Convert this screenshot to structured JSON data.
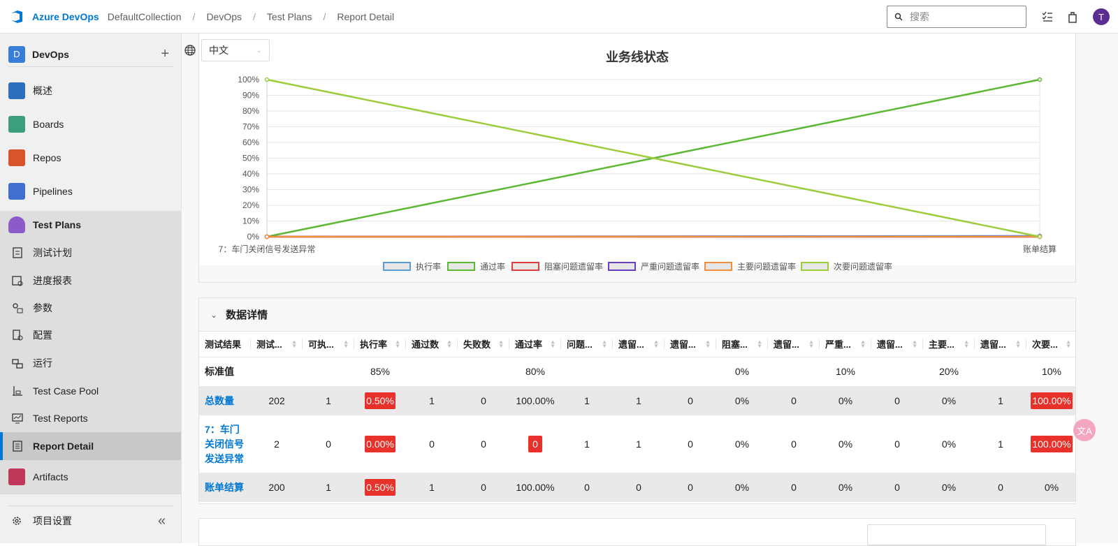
{
  "topbar": {
    "brand": "Azure DevOps",
    "breadcrumbs": [
      "DefaultCollection",
      "DevOps",
      "Test Plans",
      "Report Detail"
    ],
    "search_placeholder": "搜索",
    "avatar_initial": "T"
  },
  "sidebar": {
    "project_initial": "D",
    "project_name": "DevOps",
    "project_add": "+",
    "items": [
      {
        "label": "概述",
        "icon": "overview-icon"
      },
      {
        "label": "Boards",
        "icon": "boards-icon"
      },
      {
        "label": "Repos",
        "icon": "repos-icon"
      },
      {
        "label": "Pipelines",
        "icon": "pipelines-icon"
      },
      {
        "label": "Test Plans",
        "icon": "test-plans-icon"
      }
    ],
    "test_plans_sub": [
      {
        "label": "测试计划",
        "icon": "test-plan-icon"
      },
      {
        "label": "进度报表",
        "icon": "progress-report-icon"
      },
      {
        "label": "参数",
        "icon": "parameters-icon"
      },
      {
        "label": "配置",
        "icon": "configurations-icon"
      },
      {
        "label": "运行",
        "icon": "runs-icon"
      },
      {
        "label": "Test Case Pool",
        "icon": "test-case-pool-icon"
      },
      {
        "label": "Test Reports",
        "icon": "test-reports-icon"
      },
      {
        "label": "Report Detail",
        "icon": "report-detail-icon"
      }
    ],
    "artifacts": "Artifacts",
    "settings": "项目设置",
    "collapse": "«"
  },
  "main": {
    "language": "中文",
    "detail_title": "数据详情"
  },
  "chart_data": {
    "type": "line",
    "title": "业务线状态",
    "categories": [
      "7：车门关闭信号发送异常",
      "账单结算"
    ],
    "ylim": [
      0,
      100
    ],
    "yticks": [
      "0%",
      "10%",
      "20%",
      "30%",
      "40%",
      "50%",
      "60%",
      "70%",
      "80%",
      "90%",
      "100%"
    ],
    "grid": true,
    "legend_position": "bottom",
    "series": [
      {
        "name": "执行率",
        "values": [
          0,
          0.5
        ],
        "color": "#5b9bd5"
      },
      {
        "name": "通过率",
        "values": [
          0,
          100
        ],
        "color": "#5cb832"
      },
      {
        "name": "阻塞问题遗留率",
        "values": [
          0,
          0
        ],
        "color": "#e03c3c"
      },
      {
        "name": "严重问题遗留率",
        "values": [
          0,
          0
        ],
        "color": "#6a3fc7"
      },
      {
        "name": "主要问题遗留率",
        "values": [
          0,
          0
        ],
        "color": "#f0903c"
      },
      {
        "name": "次要问题遗留率",
        "values": [
          100,
          0
        ],
        "color": "#9ccc3c"
      }
    ]
  },
  "table": {
    "headers": [
      "测试结果",
      "测试...",
      "可执...",
      "执行率",
      "通过数",
      "失败数",
      "通过率",
      "问题...",
      "遗留...",
      "遗留...",
      "阻塞...",
      "遗留...",
      "严重...",
      "遗留...",
      "主要...",
      "遗留...",
      "次要..."
    ],
    "standard": [
      "标准值",
      "",
      "",
      "85%",
      "",
      "",
      "80%",
      "",
      "",
      "",
      "0%",
      "",
      "10%",
      "",
      "20%",
      "",
      "10%"
    ],
    "rows": [
      {
        "name": "总数量",
        "cells": [
          "202",
          "1",
          "0.50%",
          "1",
          "0",
          "100.00%",
          "1",
          "1",
          "0",
          "0%",
          "0",
          "0%",
          "0",
          "0%",
          "1",
          "100.00%"
        ],
        "red": [
          2,
          15
        ],
        "grey": true
      },
      {
        "name": "7：车门关闭信号发送异常",
        "cells": [
          "2",
          "0",
          "0.00%",
          "0",
          "0",
          "0",
          "1",
          "1",
          "0",
          "0%",
          "0",
          "0%",
          "0",
          "0%",
          "1",
          "100.00%"
        ],
        "red": [
          2,
          5,
          15
        ],
        "grey": false
      },
      {
        "name": "账单结算",
        "cells": [
          "200",
          "1",
          "0.50%",
          "1",
          "0",
          "100.00%",
          "0",
          "0",
          "0",
          "0%",
          "0",
          "0%",
          "0",
          "0%",
          "0",
          "0%"
        ],
        "red": [
          2
        ],
        "grey": true
      }
    ]
  },
  "fab": "文A"
}
